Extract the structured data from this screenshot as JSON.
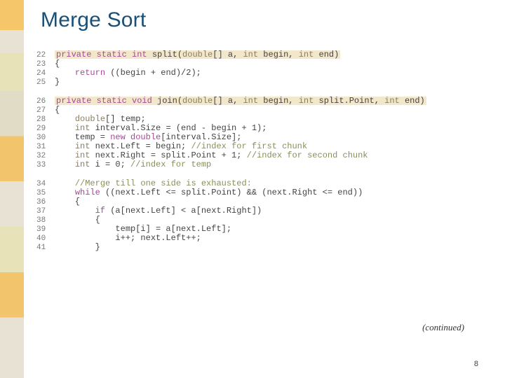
{
  "title": "Merge Sort",
  "continued": "(continued)",
  "page": "8",
  "blk1": {
    "n22": "22",
    "l22a": "private static int",
    "l22b": " split(",
    "l22c": "double",
    "l22d": "[] a, ",
    "l22e": "int",
    "l22f": " begin, ",
    "l22g": "int",
    "l22h": " end)",
    "n23": "23",
    "l23": "{",
    "n24": "24",
    "l24a": "    ",
    "l24b": "return",
    "l24c": " ((begin + end)/2);",
    "n25": "25",
    "l25": "}"
  },
  "blk2": {
    "n26": "26",
    "l26a": "private static void",
    "l26b": " join(",
    "l26c": "double",
    "l26d": "[] a, ",
    "l26e": "int",
    "l26f": " begin, ",
    "l26g": "int",
    "l26h": " split.Point, ",
    "l26i": "int",
    "l26j": " end)",
    "n27": "27",
    "l27": "{",
    "n28": "28",
    "l28a": "    ",
    "l28b": "double",
    "l28c": "[] temp;",
    "n29": "29",
    "l29a": "    ",
    "l29b": "int",
    "l29c": " interval.Size = (end - begin + 1);",
    "n30": "30",
    "l30a": "    temp = ",
    "l30b": "new double",
    "l30c": "[interval.Size];",
    "n31": "31",
    "l31a": "    ",
    "l31b": "int",
    "l31c": " next.Left = begin; ",
    "l31d": "//index for first chunk",
    "n32": "32",
    "l32a": "    ",
    "l32b": "int",
    "l32c": " next.Right = split.Point + 1; ",
    "l32d": "//index for second chunk",
    "n33": "33",
    "l33a": "    ",
    "l33b": "int",
    "l33c": " i = 0; ",
    "l33d": "//index for temp"
  },
  "blk3": {
    "n34": "34",
    "l34a": "    ",
    "l34b": "//Merge till one side is exhausted:",
    "n35": "35",
    "l35a": "    ",
    "l35b": "while",
    "l35c": " ((next.Left <= split.Point) && (next.Right <= end))",
    "n36": "36",
    "l36": "    {",
    "n37": "37",
    "l37a": "        ",
    "l37b": "if",
    "l37c": " (a[next.Left] < a[next.Right])",
    "n38": "38",
    "l38": "        {",
    "n39": "39",
    "l39": "            temp[i] = a[next.Left];",
    "n40": "40",
    "l40": "            i++; next.Left++;",
    "n41": "41",
    "l41": "        }"
  }
}
